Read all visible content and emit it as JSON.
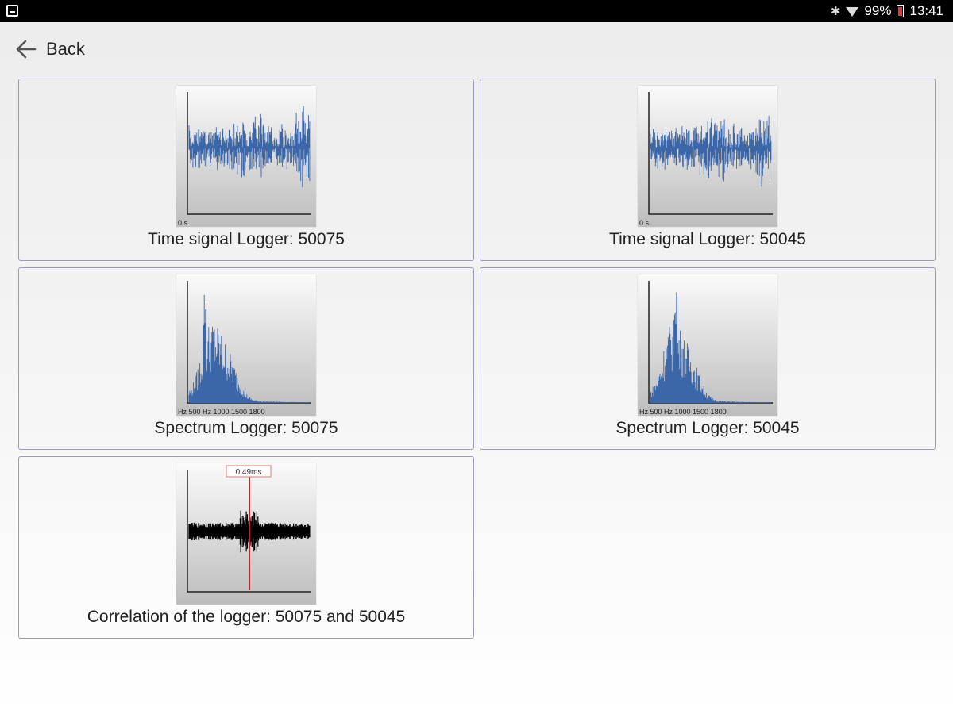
{
  "status_bar": {
    "battery": "99%",
    "time": "13:41"
  },
  "nav": {
    "back_label": "Back"
  },
  "tiles": [
    {
      "caption": "Time signal Logger: 50075",
      "kind": "time",
      "axis_label": "0 s",
      "color": "#3b66a8"
    },
    {
      "caption": "Time signal Logger: 50045",
      "kind": "time",
      "axis_label": "0 s",
      "color": "#3b66a8"
    },
    {
      "caption": "Spectrum Logger: 50075",
      "kind": "spectrum",
      "axis_label": "Hz 500 Hz 1000 1500 1800",
      "color": "#3b66a8"
    },
    {
      "caption": "Spectrum Logger: 50045",
      "kind": "spectrum",
      "axis_label": "Hz 500 Hz 1000 1500 1800",
      "color": "#3b66a8"
    },
    {
      "caption": "Correlation of the logger: 50075 and 50045",
      "kind": "correlation",
      "peak_label": "0.49ms",
      "color": "#000000",
      "marker_color": "#c62828"
    }
  ]
}
